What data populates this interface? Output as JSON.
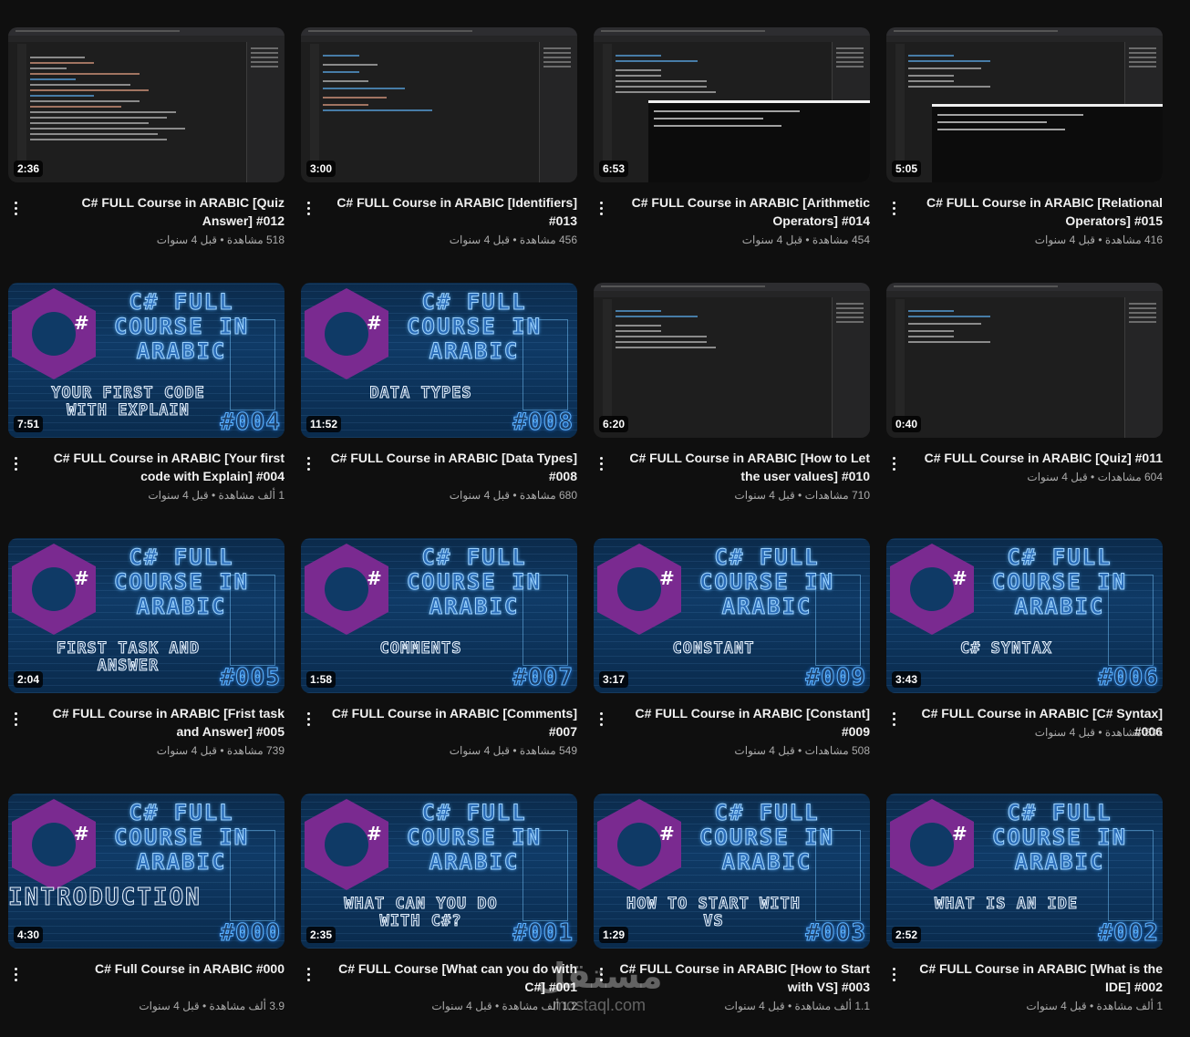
{
  "videos": [
    {
      "title": "C# FULL Course in ARABIC [Quiz Answer] #012",
      "views": "518 مشاهدة",
      "age": "قبل 4 سنوات",
      "duration": "2:36",
      "thumb": "code"
    },
    {
      "title": "C# FULL Course in ARABIC [Identifiers] #013",
      "views": "456 مشاهدة",
      "age": "قبل 4 سنوات",
      "duration": "3:00",
      "thumb": "code"
    },
    {
      "title": "C# FULL Course in ARABIC [Arithmetic Operators] #014",
      "views": "454 مشاهدة",
      "age": "قبل 4 سنوات",
      "duration": "6:53",
      "thumb": "code-console"
    },
    {
      "title": "C# FULL Course in ARABIC [Relational Operators] #015",
      "views": "416 مشاهدة",
      "age": "قبل 4 سنوات",
      "duration": "5:05",
      "thumb": "code-console"
    },
    {
      "title": "C# FULL Course in ARABIC [Your first code with Explain] #004",
      "views": "1 ألف مشاهدة",
      "age": "قبل 4 سنوات",
      "duration": "7:51",
      "thumb": "brand",
      "banner": {
        "line1": "C# FULL",
        "line2": "COURSE IN",
        "line3": "ARABIC",
        "topic": "YOUR FIRST CODE WITH EXPLAIN",
        "number": "#004"
      }
    },
    {
      "title": "C# FULL Course in ARABIC [Data Types] #008",
      "views": "680 مشاهدة",
      "age": "قبل 4 سنوات",
      "duration": "11:52",
      "thumb": "brand",
      "banner": {
        "line1": "C# FULL",
        "line2": "COURSE IN",
        "line3": "ARABIC",
        "topic": "DATA TYPES",
        "number": "#008"
      }
    },
    {
      "title": "C# FULL Course in ARABIC [How to Let the user values] #010",
      "views": "710 مشاهدات",
      "age": "قبل 4 سنوات",
      "duration": "6:20",
      "thumb": "code"
    },
    {
      "title": "C# FULL Course in ARABIC [Quiz] #011",
      "views": "604 مشاهدات",
      "age": "قبل 4 سنوات",
      "duration": "0:40",
      "thumb": "code"
    },
    {
      "title": "C# FULL Course in ARABIC [Frist task and Answer] #005",
      "views": "739 مشاهدة",
      "age": "قبل 4 سنوات",
      "duration": "2:04",
      "thumb": "brand",
      "banner": {
        "line1": "C# FULL",
        "line2": "COURSE IN",
        "line3": "ARABIC",
        "topic": "FIRST TASK AND ANSWER",
        "number": "#005"
      }
    },
    {
      "title": "C# FULL Course in ARABIC [Comments] #007",
      "views": "549 مشاهدة",
      "age": "قبل 4 سنوات",
      "duration": "1:58",
      "thumb": "brand",
      "banner": {
        "line1": "C# FULL",
        "line2": "COURSE IN",
        "line3": "ARABIC",
        "topic": "COMMENTS",
        "number": "#007"
      }
    },
    {
      "title": "C# FULL Course in ARABIC [Constant] #009",
      "views": "508 مشاهدات",
      "age": "قبل 4 سنوات",
      "duration": "3:17",
      "thumb": "brand",
      "banner": {
        "line1": "C# FULL",
        "line2": "COURSE IN",
        "line3": "ARABIC",
        "topic": "CONSTANT",
        "number": "#009"
      }
    },
    {
      "title": "C# FULL Course in ARABIC [C# Syntax] #006",
      "views": "831 مشاهدة",
      "age": "قبل 4 سنوات",
      "duration": "3:43",
      "thumb": "brand",
      "banner": {
        "line1": "C# FULL",
        "line2": "COURSE IN",
        "line3": "ARABIC",
        "topic": "C# SYNTAX",
        "number": "#006"
      }
    },
    {
      "title": "C# Full Course in ARABIC #000",
      "views": "3.9 ألف مشاهدة",
      "age": "قبل 4 سنوات",
      "duration": "4:30",
      "thumb": "brand",
      "banner": {
        "line1": "C# FULL",
        "line2": "COURSE IN",
        "line3": "ARABIC",
        "topic": "INTRODUCTION",
        "number": "#000"
      }
    },
    {
      "title": "C# FULL Course [What can you do with C#] #001",
      "views": "1.2 ألف مشاهدة",
      "age": "قبل 4 سنوات",
      "duration": "2:35",
      "thumb": "brand",
      "banner": {
        "line1": "C# FULL",
        "line2": "COURSE IN",
        "line3": "ARABIC",
        "topic": "WHAT CAN YOU DO WITH C#?",
        "number": "#001"
      }
    },
    {
      "title": "C# FULL Course in ARABIC [How to Start with VS] #003",
      "views": "1.1 ألف مشاهدة",
      "age": "قبل 4 سنوات",
      "duration": "1:29",
      "thumb": "brand",
      "banner": {
        "line1": "C# FULL",
        "line2": "COURSE IN",
        "line3": "ARABIC",
        "topic": "HOW TO START WITH VS",
        "number": "#003"
      }
    },
    {
      "title": "C# FULL Course in ARABIC [What is the IDE] #002",
      "views": "1 ألف مشاهدة",
      "age": "قبل 4 سنوات",
      "duration": "2:52",
      "thumb": "brand",
      "banner": {
        "line1": "C# FULL",
        "line2": "COURSE IN",
        "line3": "ARABIC",
        "topic": "WHAT IS AN IDE",
        "number": "#002"
      }
    }
  ],
  "watermark": {
    "arabic": "مستقل",
    "latin": "mostaql.com"
  },
  "colors": {
    "background": "#0f0f0f",
    "title": "#f1f1f1",
    "meta": "#aaaaaa",
    "hexagon": "#7a2a90",
    "banner_blue": "#0f3a66"
  }
}
